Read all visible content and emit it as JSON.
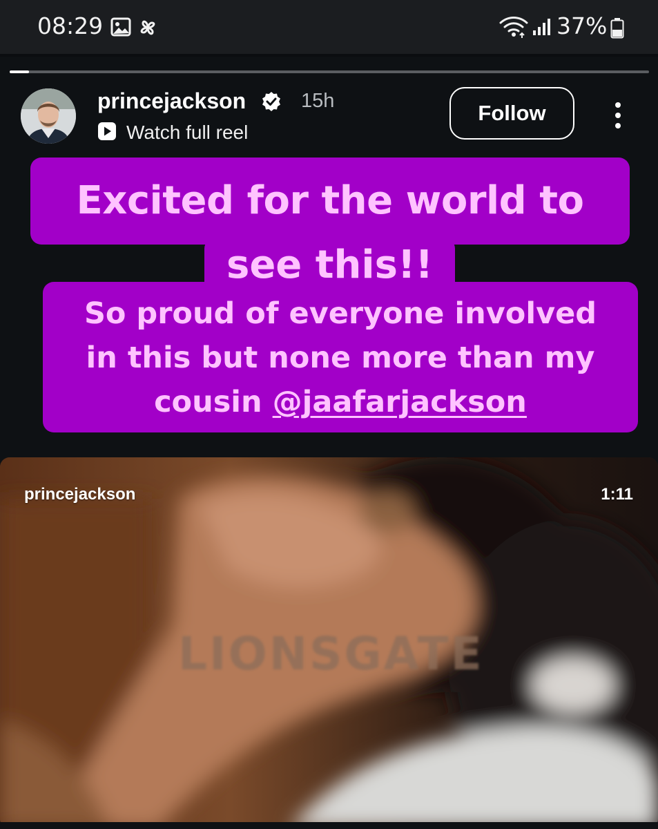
{
  "status_bar": {
    "time": "08:29",
    "icons_left": [
      "gallery-icon",
      "pinwheel-icon"
    ],
    "icons_right": [
      "wifi-icon",
      "signal-icon",
      "battery-icon"
    ],
    "battery": "37%"
  },
  "story": {
    "progress": 0.03,
    "username": "princejackson",
    "verified": true,
    "time_ago": "15h",
    "watch_full_reel": "Watch full reel",
    "follow_label": "Follow",
    "caption": {
      "line1": "Excited for the world to",
      "line2": "see this!!",
      "sub_line1": "So proud of everyone involved",
      "sub_line2": "in this but none more than my",
      "sub_line3_prefix": "cousin ",
      "mention": "@jaafarjackson"
    },
    "reel": {
      "username": "princejackson",
      "duration": "1:11",
      "watermark": "LIONSGATE"
    }
  },
  "colors": {
    "caption_bg": "#a200c8",
    "caption_text": "#ffc3ff",
    "background": "#0e1114"
  }
}
